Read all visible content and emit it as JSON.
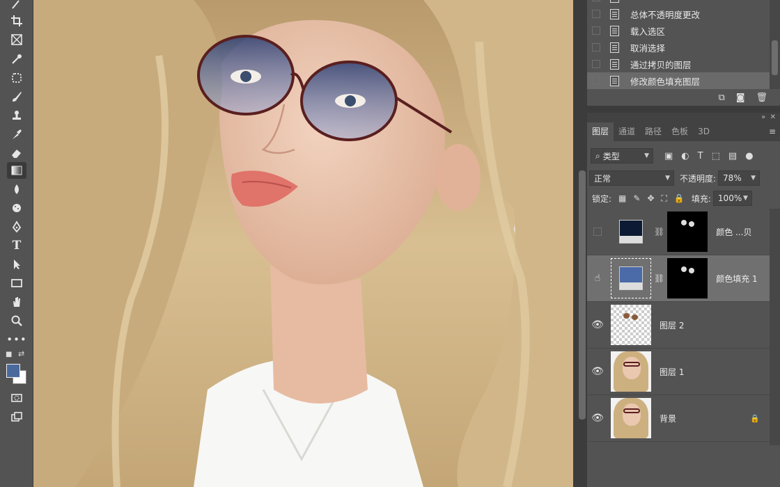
{
  "history": {
    "items": [
      {
        "label": "总体不透明度更改"
      },
      {
        "label": "载入选区"
      },
      {
        "label": "取消选择"
      },
      {
        "label": "通过拷贝的图层"
      },
      {
        "label": "修改颜色填充图层"
      }
    ],
    "selected_index": 4
  },
  "layers_panel": {
    "tabs": [
      "图层",
      "通道",
      "路径",
      "色板",
      "3D"
    ],
    "active_tab": "图层",
    "filter_kind": "类型",
    "blend_mode": "正常",
    "opacity_label": "不透明度:",
    "opacity_value": "78%",
    "lock_label": "锁定:",
    "fill_label": "填充:",
    "fill_value": "100%",
    "layers": [
      {
        "name": "颜色 ...贝",
        "visible": false,
        "type": "fill",
        "fill_color": "#0d1a33"
      },
      {
        "name": "颜色填充 1",
        "visible": true,
        "type": "fill",
        "fill_color": "#4a6aa8",
        "selected": true
      },
      {
        "name": "图层 2",
        "visible": true,
        "type": "transparent"
      },
      {
        "name": "图层 1",
        "visible": true,
        "type": "photo"
      },
      {
        "name": "背景",
        "visible": true,
        "type": "photo",
        "locked": true
      }
    ]
  },
  "colors": {
    "foreground": "#4a6a9c",
    "background": "#ffffff",
    "panel_bg": "#535353",
    "selected_layer_bg": "#707070"
  }
}
